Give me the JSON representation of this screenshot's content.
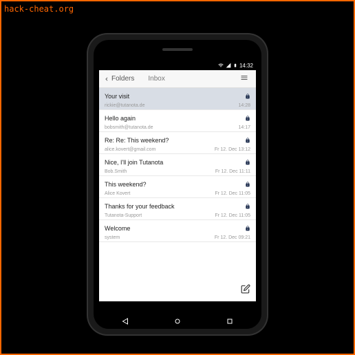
{
  "watermark": "hack-cheat.org",
  "statusbar": {
    "time": "14:32"
  },
  "appbar": {
    "back_label": "Folders",
    "title": "Inbox"
  },
  "emails": [
    {
      "subject": "Your visit",
      "sender": "rickie@tutanota.de",
      "time": "14:28",
      "selected": true
    },
    {
      "subject": "Hello again",
      "sender": "bobsmith@tutanota.de",
      "time": "14:17",
      "selected": false
    },
    {
      "subject": "Re: Re: This weekend?",
      "sender": "alice.kovert@gmail.com",
      "time": "Fr 12. Dec 13:12",
      "selected": false
    },
    {
      "subject": "Nice, I'll join Tutanota",
      "sender": "Bob.Smith",
      "time": "Fr 12. Dec 11:11",
      "selected": false
    },
    {
      "subject": "This weekend?",
      "sender": "Alice Kovert",
      "time": "Fr 12. Dec 11:05",
      "selected": false
    },
    {
      "subject": "Thanks for your feedback",
      "sender": "Tutanota-Support",
      "time": "Fr 12. Dec 11:05",
      "selected": false
    },
    {
      "subject": "Welcome",
      "sender": "system",
      "time": "Fr 12. Dec 09:21",
      "selected": false
    }
  ]
}
